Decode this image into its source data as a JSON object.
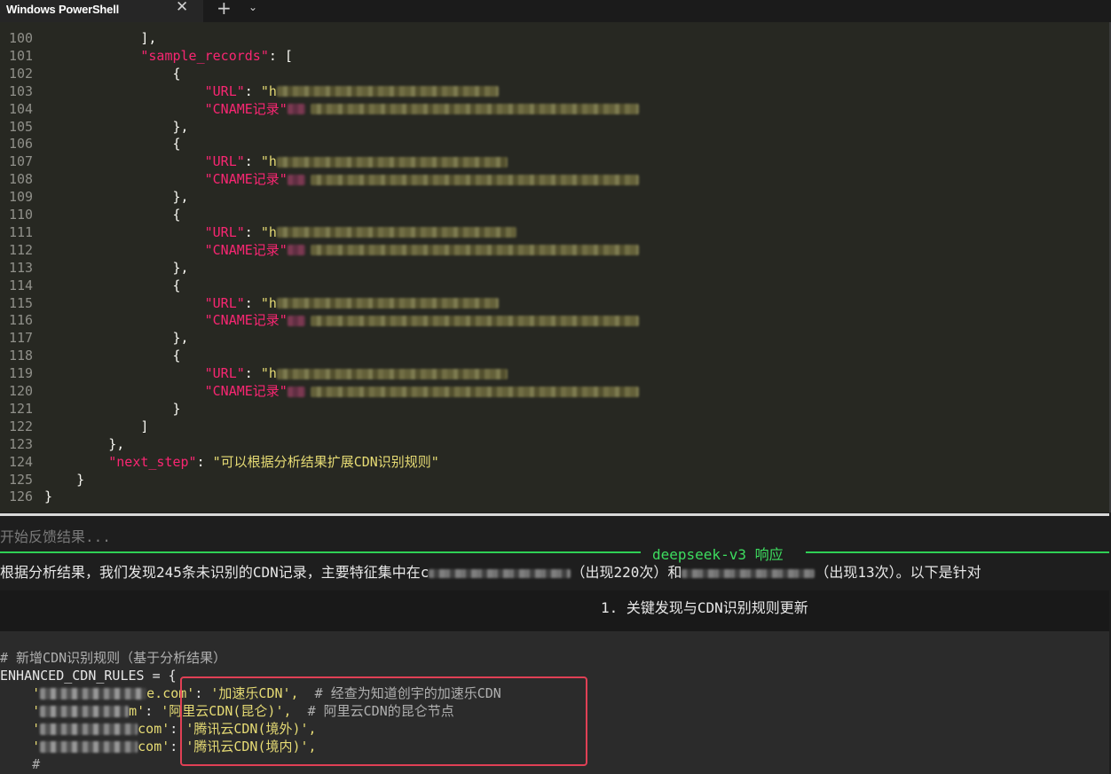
{
  "window": {
    "tab_title": "Windows PowerShell",
    "close_glyph": "✕",
    "new_tab_glyph": "+",
    "dropdown_glyph": "⌄"
  },
  "editor": {
    "lines": [
      {
        "n": "100",
        "text": "            ],"
      },
      {
        "n": "101",
        "key": "\"sample_records\"",
        "rest": ": ["
      },
      {
        "n": "102",
        "text": "                {"
      },
      {
        "n": "103",
        "key": "\"URL\"",
        "rest": ": \"h"
      },
      {
        "n": "104",
        "key": "\"CNAME记录\"",
        "rest": ""
      },
      {
        "n": "105",
        "text": "                },"
      },
      {
        "n": "106",
        "text": "                {"
      },
      {
        "n": "107",
        "key": "\"URL\"",
        "rest": ": \"h"
      },
      {
        "n": "108",
        "key": "\"CNAME记录\"",
        "rest": ""
      },
      {
        "n": "109",
        "text": "                },"
      },
      {
        "n": "110",
        "text": "                {"
      },
      {
        "n": "111",
        "key": "\"URL\"",
        "rest": ": \"h"
      },
      {
        "n": "112",
        "key": "\"CNAME记录\"",
        "rest": ""
      },
      {
        "n": "113",
        "text": "                },"
      },
      {
        "n": "114",
        "text": "                {"
      },
      {
        "n": "115",
        "key": "\"URL\"",
        "rest": ": \"h"
      },
      {
        "n": "116",
        "key": "\"CNAME记录\"",
        "rest": ""
      },
      {
        "n": "117",
        "text": "                },"
      },
      {
        "n": "118",
        "text": "                {"
      },
      {
        "n": "119",
        "key": "\"URL\"",
        "rest": ": \"h"
      },
      {
        "n": "120",
        "key": "\"CNAME记录\"",
        "rest": ""
      },
      {
        "n": "121",
        "text": "                }"
      },
      {
        "n": "122",
        "text": "            ]"
      },
      {
        "n": "123",
        "text": "        },"
      },
      {
        "n": "124",
        "key": "\"next_step\"",
        "rest": ": ",
        "value": "\"可以根据分析结果扩展CDN识别规则\""
      },
      {
        "n": "125",
        "text": "    }"
      },
      {
        "n": "126",
        "text": "}"
      }
    ]
  },
  "lower": {
    "status": "开始反馈结果...",
    "response_title": "deepseek-v3 响应",
    "response_text_a": "根据分析结果，我们发现245条未识别的CDN记录，主要特征集中在c",
    "response_text_b": "（出现220次）和",
    "response_text_c": "（出现13次）。以下是针对",
    "heading": "1. 关键发现与CDN识别规则更新",
    "code": {
      "comment1": "# 新增CDN识别规则（基于分析结果）",
      "assign": "ENHANCED_CDN_RULES = {",
      "rows": [
        {
          "domain_tail": "e.com'",
          "value": "'加速乐CDN',",
          "comment": "  # 经查为知道创宇的加速乐CDN"
        },
        {
          "domain_tail": "m'",
          "value": "'阿里云CDN(昆仑)',",
          "comment": "  # 阿里云CDN的昆仑节点"
        },
        {
          "domain_tail": "com'",
          "value": "'腾讯云CDN(境外)',",
          "comment": ""
        },
        {
          "domain_tail": "com'",
          "value": "'腾讯云CDN(境内)',",
          "comment": ""
        }
      ],
      "trailing": "    #"
    }
  }
}
